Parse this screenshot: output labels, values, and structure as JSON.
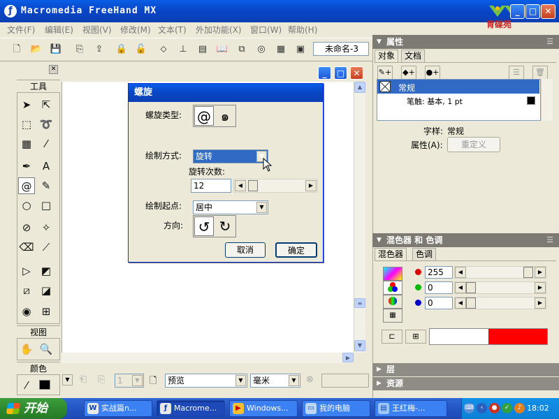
{
  "window": {
    "title": "Macromedia FreeHand MX",
    "logo_text": "育碟苑"
  },
  "menu": [
    "文件(F)",
    "编辑(E)",
    "视图(V)",
    "修改(M)",
    "文本(T)",
    "外加功能(X)",
    "窗口(W)",
    "帮助(H)"
  ],
  "toolbar": {
    "doc_name": "未命名-3"
  },
  "tools_panel": {
    "title": "工具",
    "view_title": "视图",
    "color_title": "颜色"
  },
  "dialog": {
    "title": "螺旋",
    "spiral_type_label": "螺旋类型:",
    "draw_by_label": "绘制方式:",
    "draw_by_value": "旋转",
    "rotations_label": "旋转次数:",
    "rotations_value": "12",
    "draw_from_label": "绘制起点:",
    "draw_from_value": "居中",
    "direction_label": "方向:",
    "cancel_label": "取消",
    "ok_label": "确定"
  },
  "properties": {
    "title": "属性",
    "tab_object": "对象",
    "tab_document": "文档",
    "row_normal": "常规",
    "row_stroke": "笔触: 基本, 1 pt",
    "style_label": "字样:",
    "style_value": "常规",
    "attr_label": "属性(A):",
    "redefine_label": "重定义"
  },
  "mixer": {
    "title": "混色器 和 色调",
    "tab_mixer": "混色器",
    "tab_tints": "色调",
    "r_value": "255",
    "g_value": "0",
    "b_value": "0",
    "preview_colors": [
      "#ffffff",
      "#ff0000"
    ]
  },
  "layers": {
    "title": "层"
  },
  "library": {
    "title": "资源"
  },
  "statusbar": {
    "page_value": "1",
    "view_mode": "预览",
    "units": "毫米"
  },
  "taskbar": {
    "start_label": "开始",
    "tasks": [
      "实战篇n...",
      "Macrome...",
      "Windows...",
      "我的电脑",
      "王红梅-..."
    ],
    "clock": "18:02"
  },
  "colors": {
    "titlebar": "#0846c8",
    "selection": "#316ac5",
    "taskbar": "#2455c4",
    "start": "#2f8a2f"
  }
}
